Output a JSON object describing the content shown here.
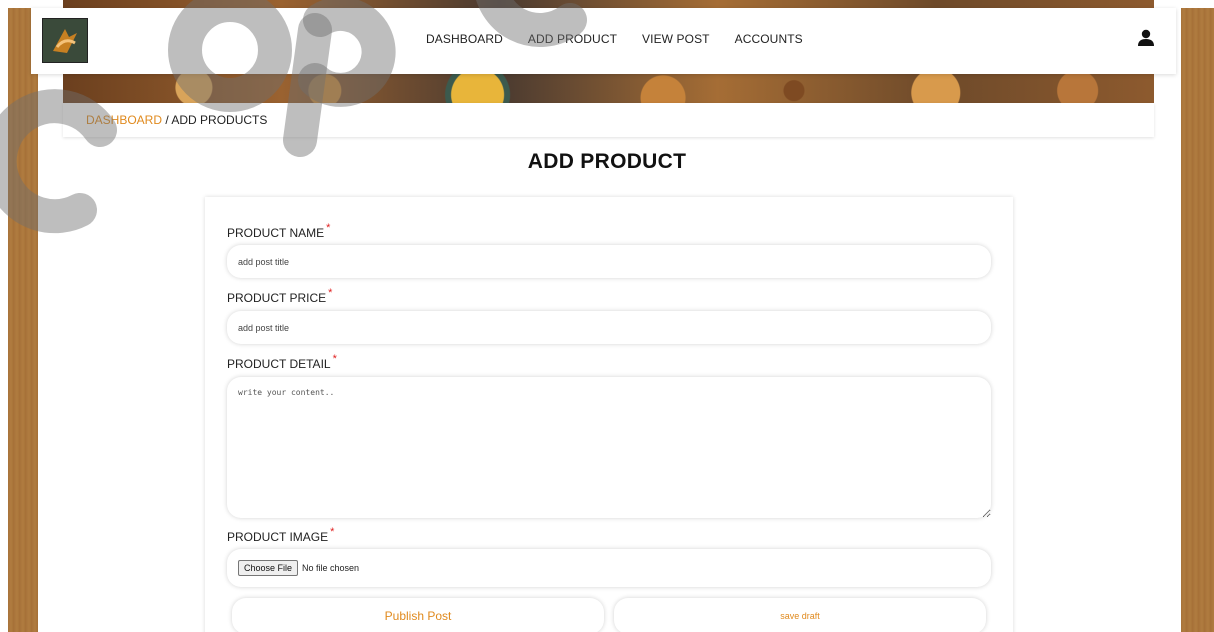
{
  "nav": {
    "links": [
      "DASHBOARD",
      "ADD PRODUCT",
      "VIEW POST",
      "ACCOUNTS"
    ]
  },
  "breadcrumb": {
    "link": "DASHBOARD",
    "separator": " / ",
    "current": "ADD PRODUCTS"
  },
  "page": {
    "title": "ADD PRODUCT"
  },
  "form": {
    "product_name_label": "PRODUCT NAME",
    "product_name_placeholder": "add post title",
    "product_price_label": "PRODUCT PRICE",
    "product_price_placeholder": "add post title",
    "product_detail_label": "PRODUCT DETAIL",
    "product_detail_placeholder": "write your content..",
    "product_image_label": "PRODUCT IMAGE",
    "choose_file_label": "Choose File",
    "no_file_text": "No file chosen",
    "required_mark": "*",
    "publish_label": "Publish Post",
    "draft_label": "save draft"
  },
  "icons": {
    "logo": "logo-icon",
    "user": "user-icon"
  },
  "colors": {
    "accent": "#e08a1e",
    "required": "#e02020",
    "side_stripe": "#a8733a"
  }
}
